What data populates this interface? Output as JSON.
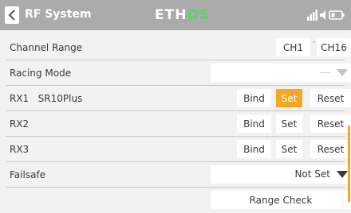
{
  "header": {
    "title": "RF System",
    "brand_part1": "ETH",
    "brand_part2": "OS",
    "brand_color": "#ffffff",
    "brand_accent": "#5cd16d"
  },
  "rows": {
    "channel_range": {
      "label": "Channel Range",
      "start": "CH1",
      "sep": "-",
      "end": "CH16"
    },
    "racing_mode": {
      "label": "Racing Mode",
      "value": "---"
    },
    "rx1": {
      "label": "RX1",
      "receiver": "SR10Plus",
      "bind": "Bind",
      "set": "Set",
      "reset": "Reset"
    },
    "rx2": {
      "label": "RX2",
      "bind": "Bind",
      "set": "Set",
      "reset": "Reset"
    },
    "rx3": {
      "label": "RX3",
      "bind": "Bind",
      "set": "Set",
      "reset": "Reset"
    },
    "failsafe": {
      "label": "Failsafe",
      "value": "Not Set"
    },
    "range_check": {
      "label": "Range Check"
    }
  },
  "colors": {
    "header_bg": "#ababab",
    "accent": "#f5a623",
    "page_bg": "#f2f2f2"
  },
  "icons": [
    "back-arrow-icon",
    "signal-bars-icon",
    "speaker-icon",
    "battery-icon",
    "caret-down-icon"
  ]
}
